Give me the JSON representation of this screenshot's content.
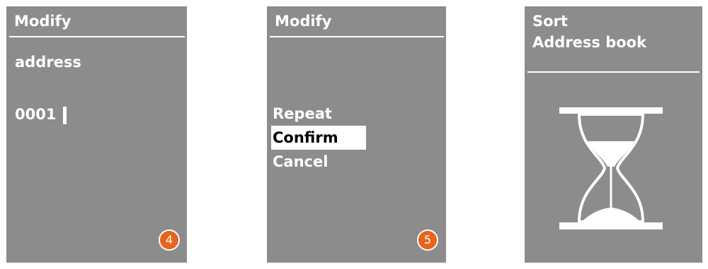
{
  "screens": [
    {
      "title": "Modify",
      "field_label": "address",
      "field_value": "0001",
      "step_number": "4"
    },
    {
      "title": "Modify",
      "menu_items": [
        "Repeat",
        "Confirm",
        "Cancel"
      ],
      "selected_item": "Confirm",
      "step_number": "5"
    },
    {
      "title_line1": "Sort",
      "title_line2": "Address book",
      "icon": "hourglass-icon"
    }
  ],
  "colors": {
    "screen_background": "#8c8c8c",
    "foreground": "#ffffff",
    "step_badge": "#e6651e",
    "selection_text": "#000000"
  }
}
